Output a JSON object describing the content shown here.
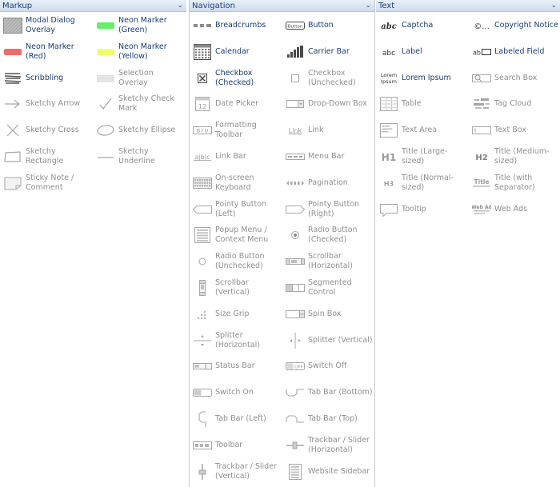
{
  "markup": {
    "title": "Markup",
    "items": [
      {
        "label": "Modal Dialog Overlay",
        "icon": "modal-overlay-icon",
        "enabled": true
      },
      {
        "label": "Neon Marker (Green)",
        "icon": "neon-marker-green-icon",
        "enabled": true,
        "color": "#66ee66"
      },
      {
        "label": "Neon Marker (Red)",
        "icon": "neon-marker-red-icon",
        "enabled": true,
        "color": "#f06a6a"
      },
      {
        "label": "Neon Marker (Yellow)",
        "icon": "neon-marker-yellow-icon",
        "enabled": true,
        "color": "#eeff66"
      },
      {
        "label": "Scribbling",
        "icon": "scribbling-icon",
        "enabled": true
      },
      {
        "label": "Selection Overlay",
        "icon": "selection-overlay-icon",
        "enabled": false
      },
      {
        "label": "Sketchy Arrow",
        "icon": "sketchy-arrow-icon",
        "enabled": false
      },
      {
        "label": "Sketchy Check Mark",
        "icon": "sketchy-check-mark-icon",
        "enabled": false
      },
      {
        "label": "Sketchy Cross",
        "icon": "sketchy-cross-icon",
        "enabled": false
      },
      {
        "label": "Sketchy Ellipse",
        "icon": "sketchy-ellipse-icon",
        "enabled": false
      },
      {
        "label": "Sketchy Rectangle",
        "icon": "sketchy-rectangle-icon",
        "enabled": false
      },
      {
        "label": "Sketchy Underline",
        "icon": "sketchy-underline-icon",
        "enabled": false
      },
      {
        "label": "Sticky Note / Comment",
        "icon": "sticky-note-icon",
        "enabled": false
      }
    ]
  },
  "navigation": {
    "title": "Navigation",
    "items": [
      {
        "label": "Breadcrumbs",
        "icon": "breadcrumbs-icon",
        "enabled": true
      },
      {
        "label": "Button",
        "icon": "button-icon",
        "icon_text": "Button",
        "enabled": true
      },
      {
        "label": "Calendar",
        "icon": "calendar-icon",
        "enabled": true
      },
      {
        "label": "Carrier Bar",
        "icon": "carrier-bar-icon",
        "enabled": true
      },
      {
        "label": "Checkbox (Checked)",
        "icon": "checkbox-checked-icon",
        "enabled": true
      },
      {
        "label": "Checkbox (Unchecked)",
        "icon": "checkbox-unchecked-icon",
        "enabled": false
      },
      {
        "label": "Date Picker",
        "icon": "date-picker-icon",
        "icon_text": "12",
        "enabled": false
      },
      {
        "label": "Drop-Down Box",
        "icon": "drop-down-box-icon",
        "enabled": false
      },
      {
        "label": "Formatting Toolbar",
        "icon": "formatting-toolbar-icon",
        "icon_text": "B I U",
        "enabled": false
      },
      {
        "label": "Link",
        "icon": "link-icon",
        "icon_text": "Link",
        "enabled": false
      },
      {
        "label": "Link Bar",
        "icon": "link-bar-icon",
        "icon_text": "a|b|c",
        "enabled": false
      },
      {
        "label": "Menu Bar",
        "icon": "menu-bar-icon",
        "enabled": false
      },
      {
        "label": "On-screen Keyboard",
        "icon": "keyboard-icon",
        "enabled": false
      },
      {
        "label": "Pagination",
        "icon": "pagination-icon",
        "enabled": false
      },
      {
        "label": "Pointy Button (Left)",
        "icon": "pointy-button-left-icon",
        "enabled": false
      },
      {
        "label": "Pointy Button (Right)",
        "icon": "pointy-button-right-icon",
        "enabled": false
      },
      {
        "label": "Popup Menu / Context Menu",
        "icon": "popup-menu-icon",
        "enabled": false
      },
      {
        "label": "Radio Button (Checked)",
        "icon": "radio-checked-icon",
        "enabled": false
      },
      {
        "label": "Radio Button (Unchecked)",
        "icon": "radio-unchecked-icon",
        "enabled": false
      },
      {
        "label": "Scrollbar (Horizontal)",
        "icon": "scrollbar-horizontal-icon",
        "enabled": false
      },
      {
        "label": "Scrollbar (Vertical)",
        "icon": "scrollbar-vertical-icon",
        "enabled": false
      },
      {
        "label": "Segmented Control",
        "icon": "segmented-control-icon",
        "enabled": false
      },
      {
        "label": "Size Grip",
        "icon": "size-grip-icon",
        "enabled": false
      },
      {
        "label": "Spin Box",
        "icon": "spin-box-icon",
        "enabled": false
      },
      {
        "label": "Splitter (Horizontal)",
        "icon": "splitter-horizontal-icon",
        "enabled": false
      },
      {
        "label": "Splitter (Vertical)",
        "icon": "splitter-vertical-icon",
        "enabled": false
      },
      {
        "label": "Status Bar",
        "icon": "status-bar-icon",
        "enabled": false
      },
      {
        "label": "Switch Off",
        "icon": "switch-off-icon",
        "icon_text": "OFF",
        "enabled": false
      },
      {
        "label": "Switch On",
        "icon": "switch-on-icon",
        "enabled": false
      },
      {
        "label": "Tab Bar (Bottom)",
        "icon": "tab-bar-bottom-icon",
        "enabled": false
      },
      {
        "label": "Tab Bar (Left)",
        "icon": "tab-bar-left-icon",
        "enabled": false
      },
      {
        "label": "Tab Bar (Top)",
        "icon": "tab-bar-top-icon",
        "enabled": false
      },
      {
        "label": "Toolbar",
        "icon": "toolbar-icon",
        "enabled": false
      },
      {
        "label": "Trackbar / Slider (Horizontal)",
        "icon": "trackbar-horizontal-icon",
        "enabled": false
      },
      {
        "label": "Trackbar / Slider (Vertical)",
        "icon": "trackbar-vertical-icon",
        "enabled": false
      },
      {
        "label": "Website Sidebar",
        "icon": "website-sidebar-icon",
        "enabled": false
      }
    ]
  },
  "text": {
    "title": "Text",
    "items": [
      {
        "label": "Captcha",
        "icon": "captcha-icon",
        "icon_text": "abc",
        "enabled": true
      },
      {
        "label": "Copyright Notice",
        "icon": "copyright-icon",
        "icon_text": "©...",
        "enabled": true
      },
      {
        "label": "Label",
        "icon": "label-icon",
        "icon_text": "abc",
        "enabled": true
      },
      {
        "label": "Labeled Field",
        "icon": "labeled-field-icon",
        "icon_text": "ab",
        "enabled": true
      },
      {
        "label": "Lorem Ipsum",
        "icon": "lorem-ipsum-icon",
        "icon_text": "Lorem Ipsum",
        "enabled": true
      },
      {
        "label": "Search Box",
        "icon": "search-box-icon",
        "enabled": false
      },
      {
        "label": "Table",
        "icon": "table-icon",
        "enabled": false
      },
      {
        "label": "Tag Cloud",
        "icon": "tag-cloud-icon",
        "enabled": false
      },
      {
        "label": "Text Area",
        "icon": "text-area-icon",
        "enabled": false
      },
      {
        "label": "Text Box",
        "icon": "text-box-icon",
        "enabled": false
      },
      {
        "label": "Title (Large-sized)",
        "icon": "title-large-icon",
        "icon_text": "H1",
        "enabled": false
      },
      {
        "label": "Title (Medium-sized)",
        "icon": "title-medium-icon",
        "icon_text": "H2",
        "enabled": false
      },
      {
        "label": "Title (Normal-sized)",
        "icon": "title-normal-icon",
        "icon_text": "H3",
        "enabled": false
      },
      {
        "label": "Title (with Separator)",
        "icon": "title-separator-icon",
        "icon_text": "Title",
        "enabled": false
      },
      {
        "label": "Tooltip",
        "icon": "tooltip-icon",
        "enabled": false
      },
      {
        "label": "Web Ads",
        "icon": "web-ads-icon",
        "icon_text": "Web Ad",
        "enabled": false
      }
    ]
  }
}
